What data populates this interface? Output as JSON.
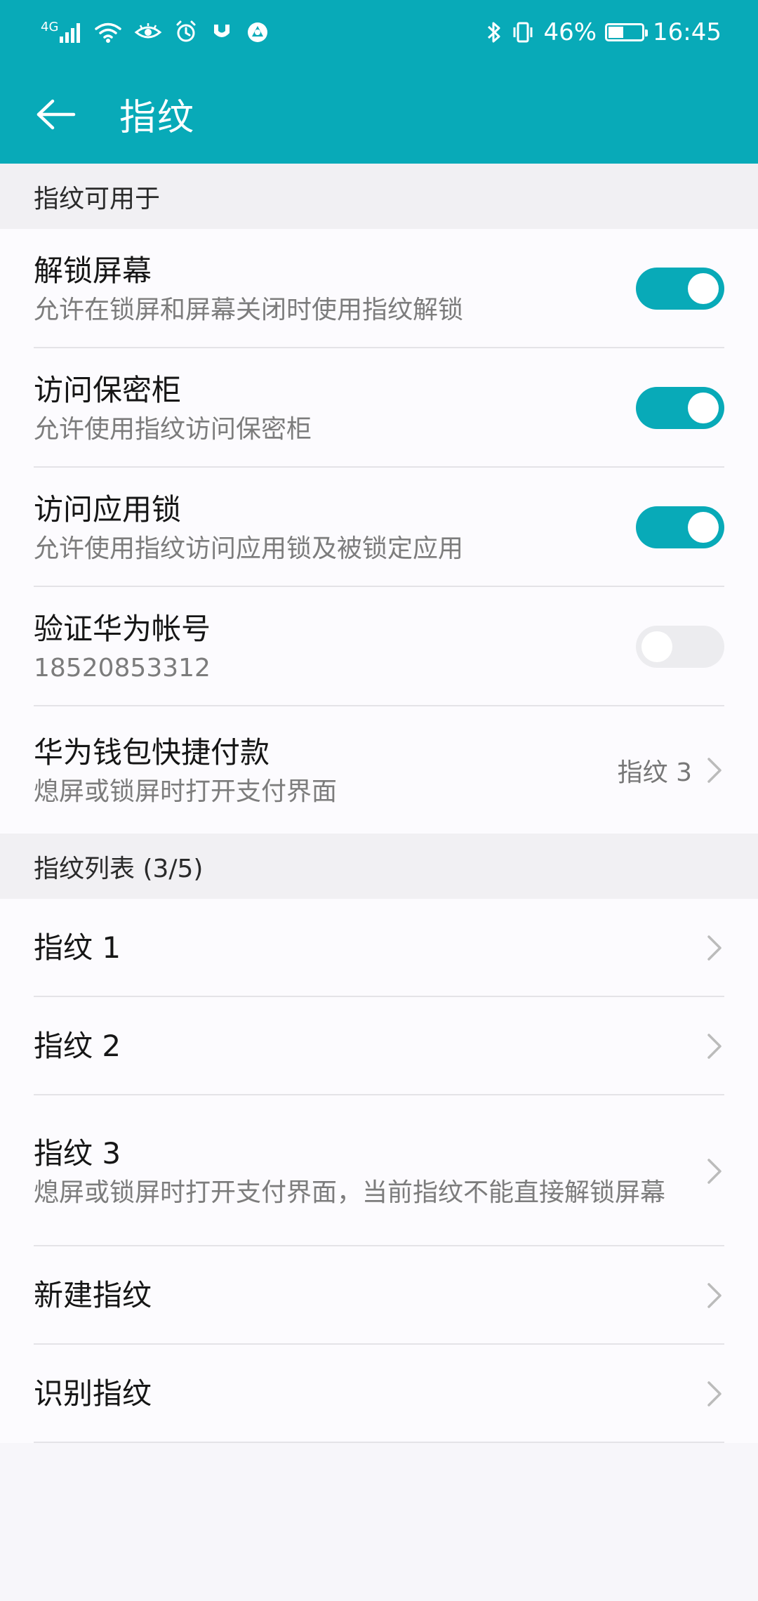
{
  "status_bar": {
    "network": "4G",
    "battery": "46%",
    "battery_fill": 0.46,
    "time": "16:45"
  },
  "header": {
    "title": "指纹"
  },
  "sections": {
    "usage": {
      "title": "指纹可用于",
      "items": [
        {
          "title": "解锁屏幕",
          "subtitle": "允许在锁屏和屏幕关闭时使用指纹解锁",
          "enabled": true
        },
        {
          "title": "访问保密柜",
          "subtitle": "允许使用指纹访问保密柜",
          "enabled": true
        },
        {
          "title": "访问应用锁",
          "subtitle": "允许使用指纹访问应用锁及被锁定应用",
          "enabled": true
        },
        {
          "title": "验证华为帐号",
          "subtitle": "18520853312",
          "enabled": false
        },
        {
          "title": "华为钱包快捷付款",
          "subtitle": "熄屏或锁屏时打开支付界面",
          "value": "指纹 3"
        }
      ]
    },
    "fingerprints": {
      "title": "指纹列表 (3/5)",
      "items": [
        {
          "title": "指纹 1"
        },
        {
          "title": "指纹 2"
        },
        {
          "title": "指纹 3",
          "subtitle": "熄屏或锁屏时打开支付界面，当前指纹不能直接解锁屏幕"
        },
        {
          "title": "新建指纹"
        },
        {
          "title": "识别指纹"
        }
      ]
    }
  },
  "colors": {
    "accent": "#08aab8",
    "background": "#f7f6fa",
    "toggle_off": "#ececef"
  }
}
